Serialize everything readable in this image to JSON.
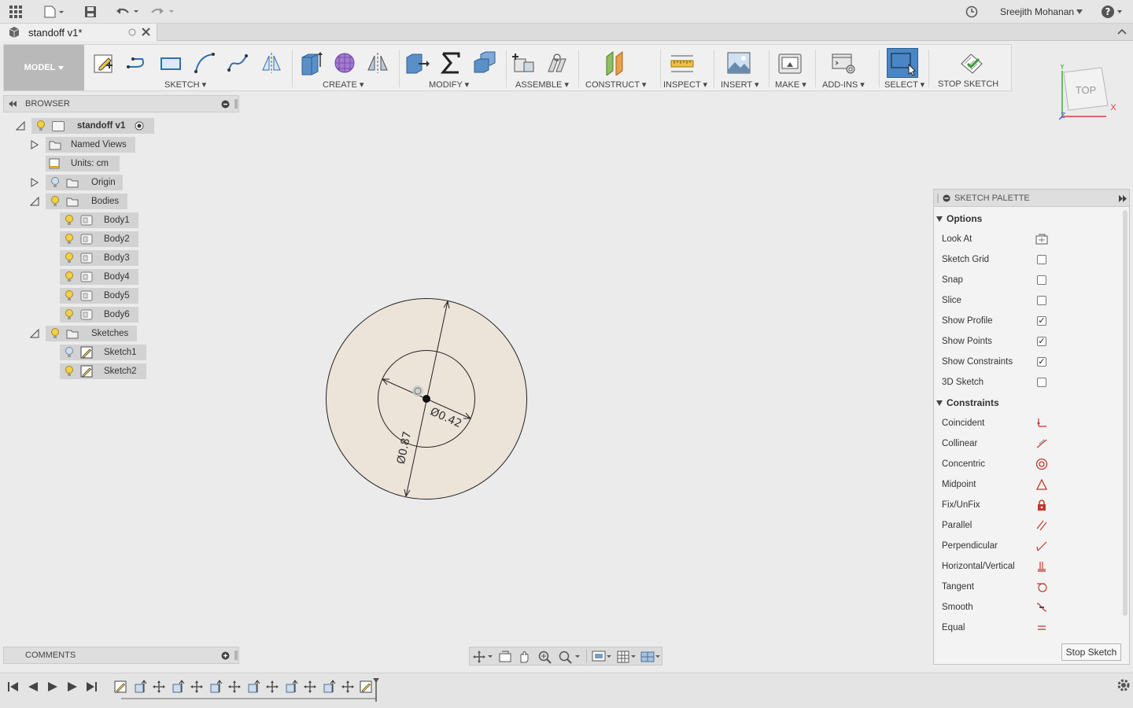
{
  "user": {
    "name": "Sreejith Mohanan"
  },
  "document": {
    "tab_title": "standoff v1*"
  },
  "ribbon": {
    "mode": "MODEL",
    "groups": {
      "sketch": "SKETCH",
      "create": "CREATE",
      "modify": "MODIFY",
      "assemble": "ASSEMBLE",
      "construct": "CONSTRUCT",
      "inspect": "INSPECT",
      "insert": "INSERT",
      "make": "MAKE",
      "addins": "ADD-INS",
      "select": "SELECT",
      "stop_sketch": "STOP SKETCH"
    }
  },
  "viewcube": {
    "face": "TOP",
    "axis_x": "X",
    "axis_y": "Y",
    "axis_z": "Z"
  },
  "browser": {
    "title": "BROWSER",
    "root": "standoff v1",
    "named_views": "Named Views",
    "units": "Units: cm",
    "origin": "Origin",
    "bodies": "Bodies",
    "body_items": [
      "Body1",
      "Body2",
      "Body3",
      "Body4",
      "Body5",
      "Body6"
    ],
    "sketches": "Sketches",
    "sketch_items": [
      "Sketch1",
      "Sketch2"
    ]
  },
  "comments": {
    "title": "COMMENTS"
  },
  "drawing": {
    "dim_inner": "Ø0.42",
    "dim_outer": "Ø0.87",
    "fill_color": "#ede4d9"
  },
  "palette": {
    "title": "SKETCH PALETTE",
    "options_title": "Options",
    "options": [
      {
        "label": "Look At",
        "type": "icon"
      },
      {
        "label": "Sketch Grid",
        "checked": false
      },
      {
        "label": "Snap",
        "checked": false
      },
      {
        "label": "Slice",
        "checked": false
      },
      {
        "label": "Show Profile",
        "checked": true
      },
      {
        "label": "Show Points",
        "checked": true
      },
      {
        "label": "Show Constraints",
        "checked": true
      },
      {
        "label": "3D Sketch",
        "checked": false
      }
    ],
    "constraints_title": "Constraints",
    "constraints": [
      {
        "label": "Coincident",
        "icon": "coincident-icon"
      },
      {
        "label": "Collinear",
        "icon": "collinear-icon"
      },
      {
        "label": "Concentric",
        "icon": "concentric-icon"
      },
      {
        "label": "Midpoint",
        "icon": "midpoint-icon"
      },
      {
        "label": "Fix/UnFix",
        "icon": "lock-icon"
      },
      {
        "label": "Parallel",
        "icon": "parallel-icon"
      },
      {
        "label": "Perpendicular",
        "icon": "perpendicular-icon"
      },
      {
        "label": "Horizontal/Vertical",
        "icon": "horizontal-vertical-icon"
      },
      {
        "label": "Tangent",
        "icon": "tangent-icon"
      },
      {
        "label": "Smooth",
        "icon": "smooth-icon"
      },
      {
        "label": "Equal",
        "icon": "equal-icon"
      }
    ],
    "stop_button": "Stop Sketch"
  },
  "colors": {
    "accent": "#3a7dbf",
    "constraint_red": "#c0392b",
    "select_active": "#4a86c5"
  }
}
